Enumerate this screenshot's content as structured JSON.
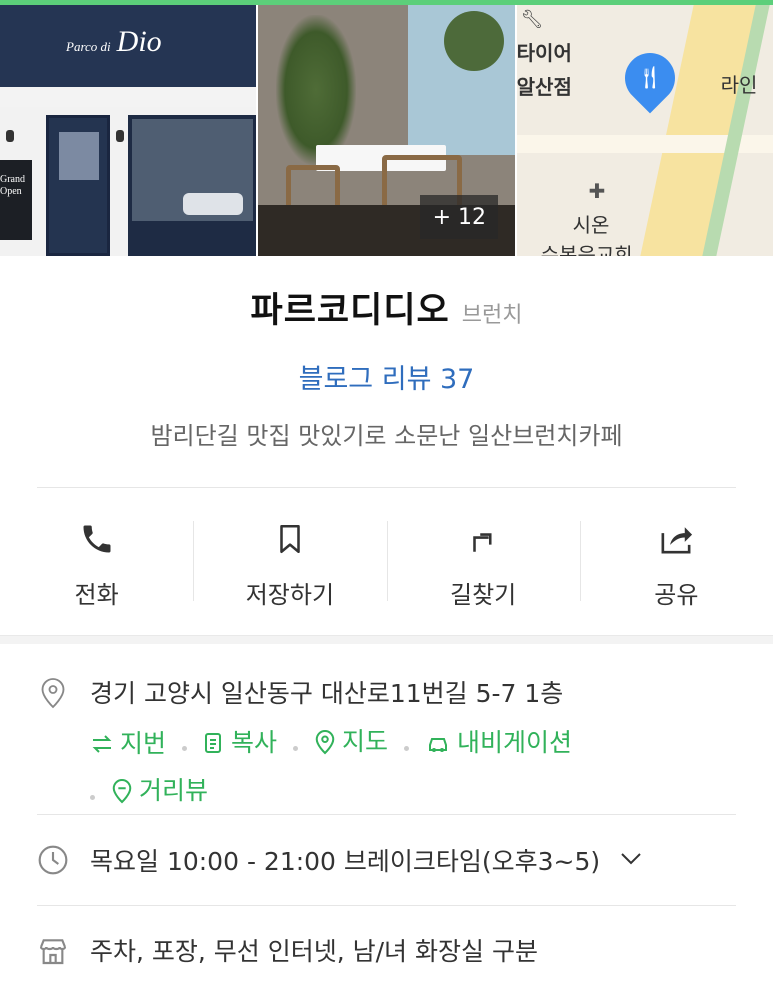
{
  "gallery": {
    "store_sign_small": "Parco di",
    "store_sign_big": "Dio",
    "poster_text": "Grand Open",
    "more_photos": "+ 12",
    "map_labels": {
      "label1": "타이어",
      "label2": "알산점",
      "label3": "라인",
      "label4": "시온",
      "label5": "수복음교회"
    }
  },
  "place": {
    "name": "파르코디디오",
    "category": "브런치",
    "review": "블로그 리뷰 37",
    "description": "밤리단길 맛집 맛있기로 소문난 일산브런치카페"
  },
  "actions": [
    {
      "label": "전화",
      "icon": "phone-icon"
    },
    {
      "label": "저장하기",
      "icon": "bookmark-icon"
    },
    {
      "label": "길찾기",
      "icon": "directions-icon"
    },
    {
      "label": "공유",
      "icon": "share-icon"
    }
  ],
  "address": {
    "text": "경기 고양시 일산동구 대산로11번길 5-7 1층",
    "links": [
      "지번",
      "복사",
      "지도",
      "내비게이션",
      "거리뷰"
    ]
  },
  "hours": {
    "text": "목요일 10:00 - 21:00 브레이크타임(오후3~5)"
  },
  "amenities": {
    "text": "주차, 포장, 무선 인터넷, 남/녀 화장실 구분"
  },
  "colors": {
    "accent_green": "#31b25a",
    "link_blue": "#2f6dbd",
    "pin_blue": "#3b8df0"
  }
}
